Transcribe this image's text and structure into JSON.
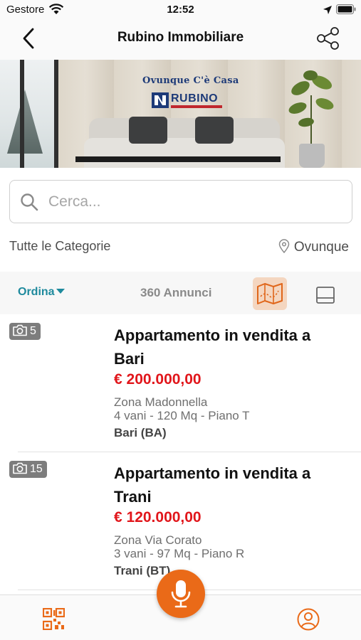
{
  "status_bar": {
    "carrier": "Gestore",
    "time": "12:52"
  },
  "nav": {
    "title": "Rubino Immobiliare",
    "back_icon": "chevron-left-icon",
    "share_icon": "share-icon"
  },
  "banner": {
    "slogan": "Ovunque C'è Casa",
    "brand": "RUBINO"
  },
  "search": {
    "placeholder": "Cerca...",
    "value": ""
  },
  "filters": {
    "category": "Tutte le Categorie",
    "location": "Ovunque"
  },
  "toolbar": {
    "sort_label": "Ordina",
    "results_count": "360 Annunci"
  },
  "listings": [
    {
      "photo_count": "5",
      "title": "Appartamento in vendita a Bari",
      "price": "€ 200.000,00",
      "zone": "Zona Madonnella",
      "details": "4 vani - 120 Mq - Piano T",
      "city": "Bari (BA)"
    },
    {
      "photo_count": "15",
      "title": "Appartamento in vendita a Trani",
      "price": "€ 120.000,00",
      "zone": "Zona Via Corato",
      "details": "3 vani - 97 Mq - Piano R",
      "city": "Trani (BT)"
    }
  ],
  "colors": {
    "accent": "#ea6a18",
    "price": "#e1161b",
    "sort": "#1e8a9d",
    "map_bg": "#f4d6c0"
  }
}
